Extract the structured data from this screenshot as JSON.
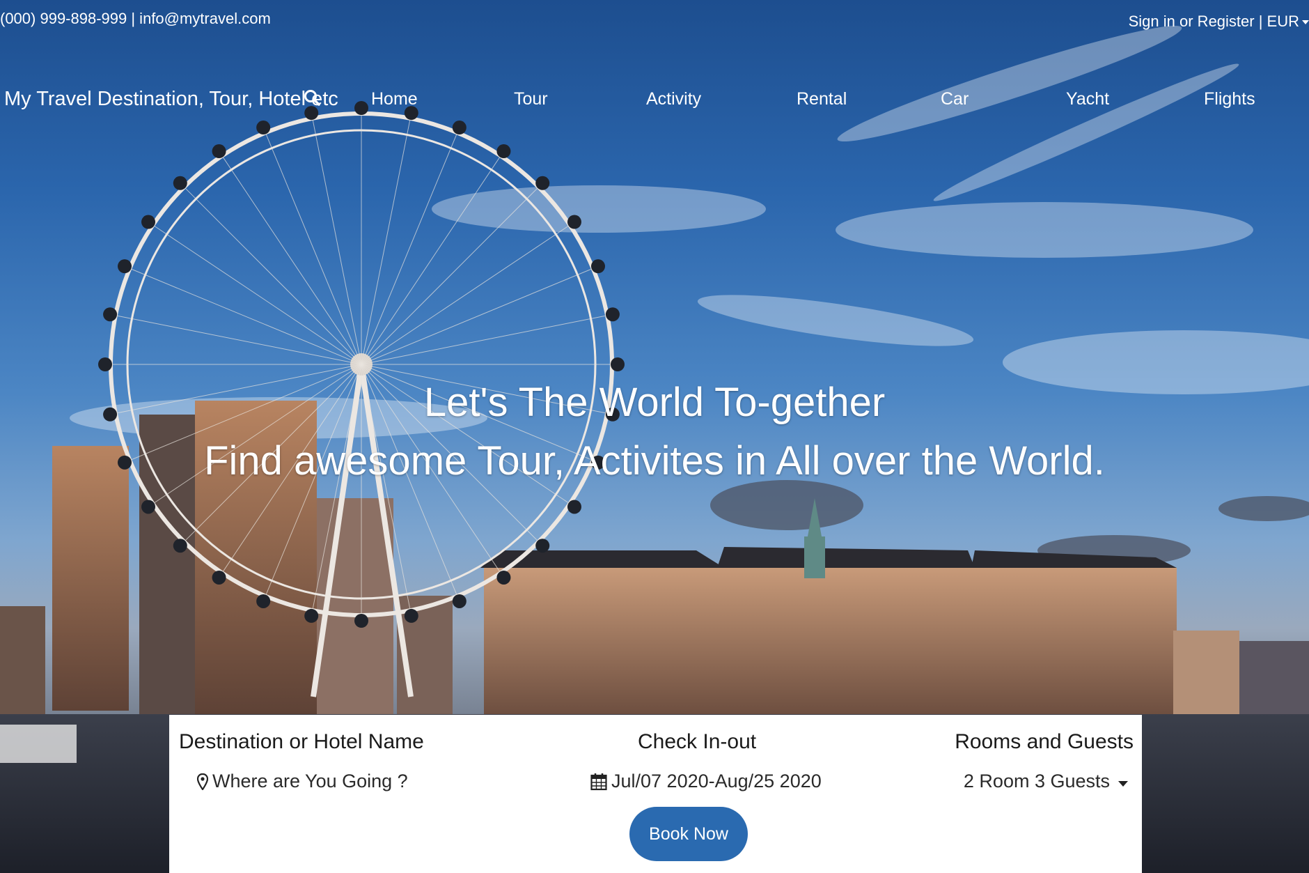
{
  "topbar": {
    "contact": "(000) 999-898-999 | info@mytravel.com",
    "account": "Sign in or Register | EUR"
  },
  "navbar": {
    "brand": "My Travel Destination, Tour, Hotel etc",
    "items": [
      {
        "label": "Home"
      },
      {
        "label": "Tour"
      },
      {
        "label": "Activity"
      },
      {
        "label": "Rental"
      },
      {
        "label": "Car"
      },
      {
        "label": "Yacht"
      },
      {
        "label": "Flights"
      }
    ]
  },
  "hero": {
    "line1": "Let's The World To-gether",
    "line2": "Find awesome Tour, Activites in All over the World."
  },
  "booking": {
    "destination_label": "Destination or Hotel Name",
    "destination_value": "Where are You Going ?",
    "checkin_label": "Check In-out",
    "checkin_value": "Jul/07 2020-Aug/25 2020",
    "guests_label": "Rooms and Guests",
    "guests_value": "2 Room 3 Guests",
    "book_button": "Book Now"
  },
  "colors": {
    "accent": "#2a6ab0",
    "sky": "#2b66ad",
    "text_light": "#ffffff"
  }
}
